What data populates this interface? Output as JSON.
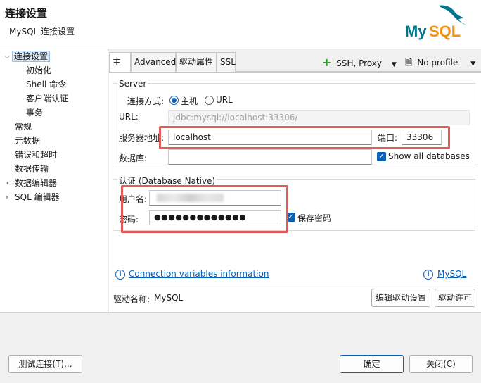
{
  "header": {
    "title": "连接设置",
    "subtitle": "MySQL 连接设置",
    "logo_text": "MySQL",
    "logo_colors": {
      "my": "#00758f",
      "sql": "#f29111"
    }
  },
  "tree": {
    "items": [
      {
        "label": "连接设置",
        "expanded": true,
        "selected": true
      },
      {
        "label": "初始化"
      },
      {
        "label": "Shell 命令"
      },
      {
        "label": "客户端认证"
      },
      {
        "label": "事务"
      },
      {
        "label": "常规"
      },
      {
        "label": "元数据"
      },
      {
        "label": "错误和超时"
      },
      {
        "label": "数据传输"
      },
      {
        "label": "数据编辑器",
        "expanded": false
      },
      {
        "label": "SQL 编辑器",
        "expanded": false
      }
    ]
  },
  "tabs": [
    {
      "label": "主要",
      "active": true
    },
    {
      "label": "Advanced"
    },
    {
      "label": "驱动属性"
    },
    {
      "label": "SSL"
    }
  ],
  "toolbar": {
    "ssh_proxy": "SSH, Proxy",
    "profile": "No profile"
  },
  "server": {
    "group_label": "Server",
    "connect_mode_label": "连接方式:",
    "host_option": "主机",
    "url_option": "URL",
    "url_label": "URL:",
    "url_value": "jdbc:mysql://localhost:33306/",
    "host_label": "服务器地址:",
    "host_value": "localhost",
    "port_label": "端口:",
    "port_value": "33306",
    "database_label": "数据库:",
    "database_value": "",
    "show_all_databases": "Show all databases"
  },
  "auth": {
    "group_label": "认证 (Database Native)",
    "username_label": "用户名:",
    "password_label": "密码:",
    "password_value": "●●●●●●●●●●●●●",
    "save_password": "保存密码"
  },
  "links": {
    "connection_variables": "Connection variables information",
    "mysql": "MySQL"
  },
  "driver": {
    "label": "驱动名称:",
    "name": "MySQL",
    "edit_button": "编辑驱动设置",
    "license_button": "驱动许可"
  },
  "footer": {
    "test_button": "测试连接(T)...",
    "ok_button": "确定",
    "close_button": "关闭(C)"
  },
  "colors": {
    "accent": "#0b5fb4",
    "highlight": "#e85a5a",
    "add_icon": "#2ca02c"
  }
}
